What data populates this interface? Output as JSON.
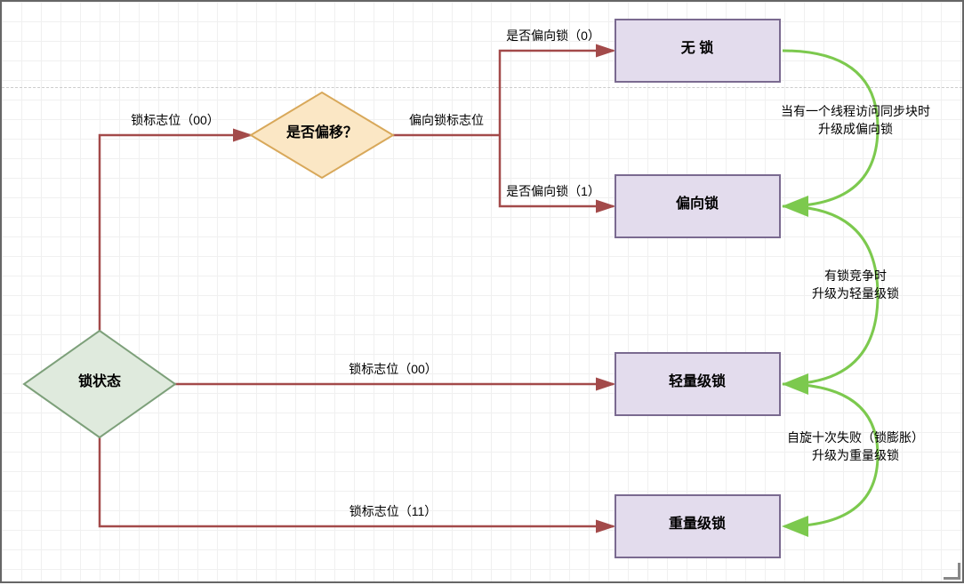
{
  "nodes": {
    "start": {
      "label": "锁状态"
    },
    "isBias": {
      "label": "是否偏移？"
    },
    "noLock": {
      "label": "无 锁"
    },
    "biasLock": {
      "label": "偏向锁"
    },
    "lwLock": {
      "label": "轻量级锁"
    },
    "hwLock": {
      "label": "重量级锁"
    }
  },
  "edges": {
    "e1": {
      "label": "锁标志位（00）"
    },
    "e2": {
      "label": "偏向锁标志位"
    },
    "e3": {
      "label": "是否偏向锁（0）"
    },
    "e4": {
      "label": "是否偏向锁（1）"
    },
    "e5": {
      "label": "锁标志位（00）"
    },
    "e6": {
      "label": "锁标志位（11）"
    }
  },
  "notes": {
    "n1a": "当有一个线程访问同步块时",
    "n1b": "升级成偏向锁",
    "n2a": "有锁竞争时",
    "n2b": "升级为轻量级锁",
    "n3a": "自旋十次失败（锁膨胀）",
    "n3b": "升级为重量级锁"
  },
  "colors": {
    "boxFill": "#e3dced",
    "boxStroke": "#7a6a90",
    "diamondStartFill": "#dfeadd",
    "diamondStartStroke": "#7da07a",
    "diamondBiasFill": "#fbe7c5",
    "diamondBiasStroke": "#d8a85a",
    "connector": "#a34a4a",
    "upgradeArrow": "#7cc94e"
  }
}
